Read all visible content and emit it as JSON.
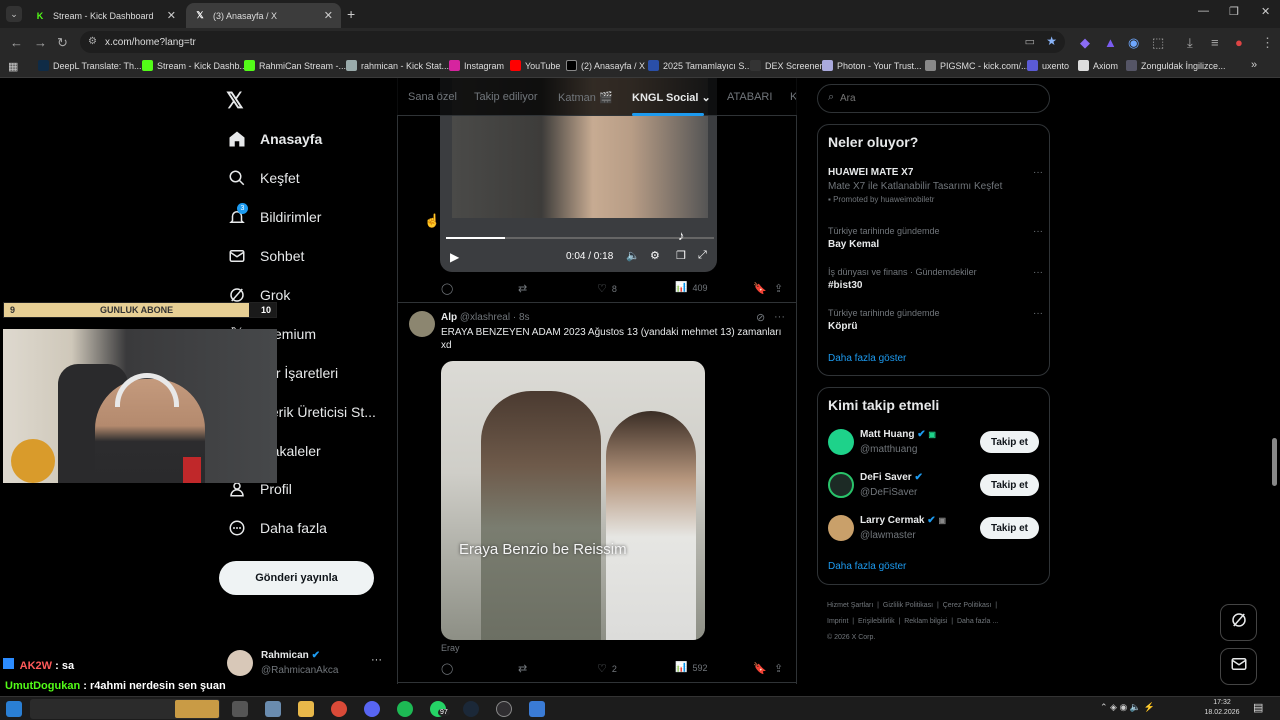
{
  "browser": {
    "tabs": [
      {
        "title": "Stream - Kick Dashboard",
        "active": false
      },
      {
        "title": "(3) Anasayfa / X",
        "active": true
      }
    ],
    "url": "x.com/home?lang=tr",
    "bookmarks": [
      "DeepL Translate: Th...",
      "Stream - Kick Dashb...",
      "RahmiCan Stream -...",
      "rahmican - Kick Stat...",
      "Instagram",
      "YouTube",
      "(2) Anasayfa / X",
      "2025 Tamamlayıcı S...",
      "DEX Screener",
      "Photon - Your Trust...",
      "PIGSMC - kick.com/...",
      "uxento",
      "Axiom",
      "Zonguldak İngilizce..."
    ]
  },
  "nav": {
    "items": [
      {
        "label": "Anasayfa",
        "icon": "home-icon"
      },
      {
        "label": "Keşfet",
        "icon": "search-icon"
      },
      {
        "label": "Bildirimler",
        "icon": "bell-icon"
      },
      {
        "label": "Sohbet",
        "icon": "mail-icon"
      },
      {
        "label": "Grok",
        "icon": "grok-icon"
      },
      {
        "label": "Premium",
        "icon": "x-icon"
      },
      {
        "label": "Yer İşaretleri",
        "icon": "bookmark-icon"
      },
      {
        "label": "İçerik Üreticisi St...",
        "icon": "studio-icon"
      },
      {
        "label": "Makaleler",
        "icon": "article-icon"
      },
      {
        "label": "Profil",
        "icon": "profile-icon"
      },
      {
        "label": "Daha fazla",
        "icon": "more-icon"
      }
    ],
    "notification_badge": "3",
    "post_button": "Gönderi yayınla",
    "account": {
      "name": "Rahmican",
      "handle": "@RahmicanAkca"
    }
  },
  "feed": {
    "tabs": [
      "Sana özel",
      "Takip ediliyor",
      "Katman 🎬",
      "KNGL Social",
      "ATABARI",
      "K"
    ],
    "video": {
      "time": "0:04 / 0:18",
      "progress": 0.22
    },
    "post1_actions": {
      "replies": "",
      "reposts": "",
      "likes": "8",
      "views": "409"
    },
    "post2": {
      "name": "Alp",
      "handle": "@xlashreal",
      "time": "8s",
      "text": "ERAYA BENZEYEN ADAM 2023 Ağustos 13 (yandaki mehmet 13) zamanları xd",
      "image_caption": "Eraya Benzio be Reissim",
      "image_source": "Eray",
      "likes": "2",
      "views": "592"
    }
  },
  "search": {
    "placeholder": "Ara"
  },
  "trends": {
    "title": "Neler oluyor?",
    "items": [
      {
        "meta": "",
        "title": "HUAWEI MATE X7",
        "sub": "Mate X7 ile Katlanabilir Tasarımı Keşfet",
        "promo": "Promoted by huaweimobiletr"
      },
      {
        "meta": "Türkiye tarihinde gündemde",
        "title": "Bay Kemal"
      },
      {
        "meta": "İş dünyası ve finans · Gündemdekiler",
        "title": "#bist30"
      },
      {
        "meta": "Türkiye tarihinde gündemde",
        "title": "Köprü"
      }
    ],
    "more": "Daha fazla göster"
  },
  "who_to_follow": {
    "title": "Kimi takip etmeli",
    "accounts": [
      {
        "name": "Matt Huang",
        "handle": "@matthuang",
        "avatar_color": "#1ed28a"
      },
      {
        "name": "DeFi Saver",
        "handle": "@DeFiSaver",
        "avatar_color": "#1c2a25"
      },
      {
        "name": "Larry Cermak",
        "handle": "@lawmaster",
        "avatar_color": "#c9a06a"
      }
    ],
    "button": "Takip et",
    "more": "Daha fazla göster"
  },
  "footer": {
    "row1": [
      "Hizmet Şartları",
      "Gizlilik Politikası",
      "Çerez Politikası"
    ],
    "row2": [
      "Imprint",
      "Erişilebilirlik",
      "Reklam bilgisi",
      "Daha fazla ..."
    ],
    "copyright": "© 2026 X Corp."
  },
  "overlay": {
    "sub_goal_current": "9",
    "sub_goal_label": "GUNLUK ABONE",
    "sub_goal_target": "10",
    "sub_goal_progress": 0.9,
    "chat": [
      {
        "user": "AK2W",
        "message": ": sa",
        "color": "#ff5a5a"
      },
      {
        "user": "UmutDogukan",
        "message": ": r4ahmi nerdesin sen şuan",
        "color": "#53fc18"
      }
    ]
  },
  "taskbar": {
    "time": "17:32",
    "date": "18.02.2026",
    "whatsapp_badge": "97"
  },
  "colors": {
    "accent": "#1d9bf0",
    "kick": "#53fc18",
    "bg": "#000000",
    "border": "#2f3336"
  }
}
